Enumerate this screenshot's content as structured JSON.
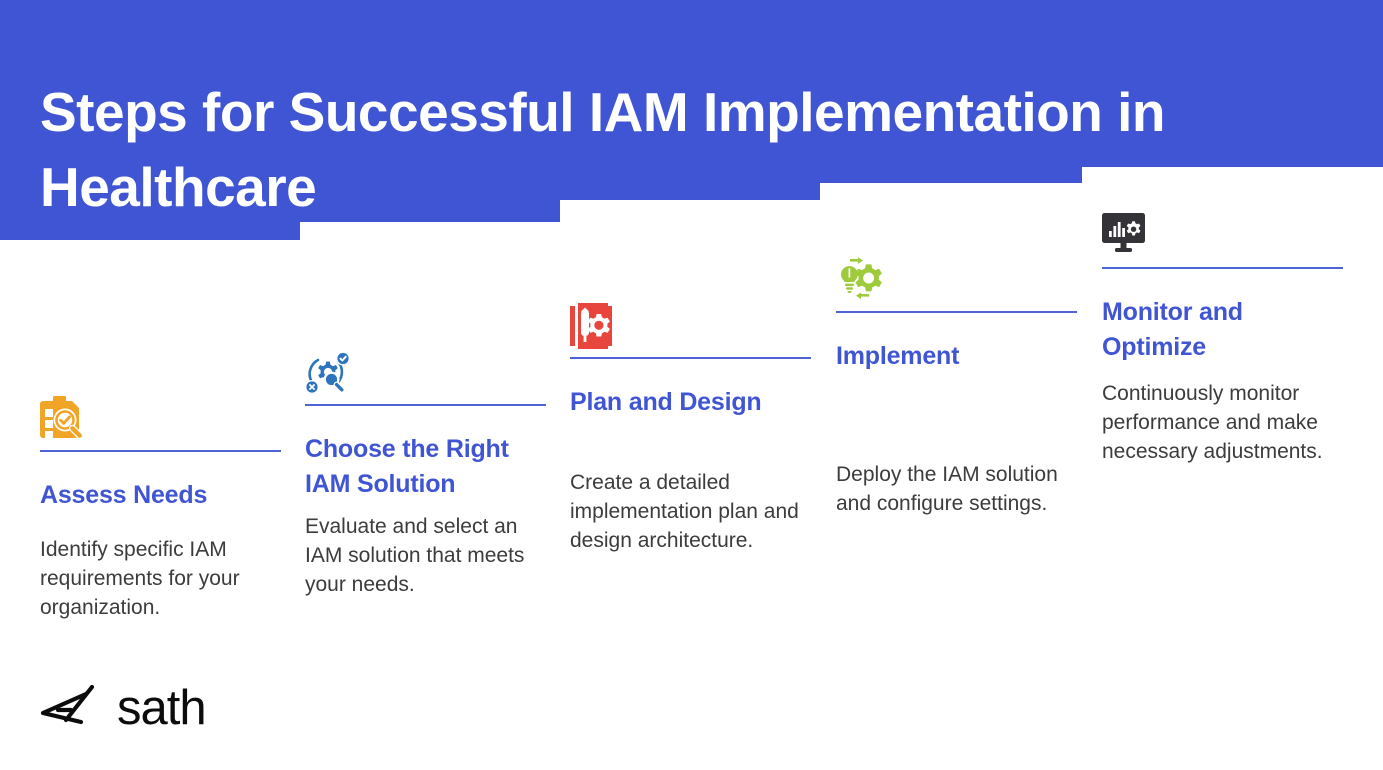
{
  "colors": {
    "header_blue": "#4055d4",
    "heading_blue": "#4055d4",
    "rule_blue": "#4f62d6",
    "body_gray": "#3c3c3c",
    "icon_orange": "#f0a526",
    "icon_blue": "#2d74bd",
    "icon_red": "#e8453c",
    "icon_green": "#9dcb3b",
    "icon_dark": "#343438",
    "background": "#ffffff"
  },
  "header": {
    "title": "Steps for Successful IAM Implementation in Healthcare",
    "title_line_1": "Steps for Successful IAM Implementation",
    "title_line_2": "in Healthcare"
  },
  "steps": [
    {
      "icon": "clipboard-search-icon",
      "heading": "Assess Needs",
      "body": "Identify specific IAM requirements for your organization."
    },
    {
      "icon": "gear-magnifier-icon",
      "heading": "Choose the Right IAM Solution",
      "body": "Evaluate and select an IAM solution that meets your needs."
    },
    {
      "icon": "blueprint-design-icon",
      "heading": "Plan and Design",
      "body": "Create a detailed implementation plan and design architecture."
    },
    {
      "icon": "lightbulb-gear-deploy-icon",
      "heading": "Implement",
      "body": "Deploy the IAM solution and configure settings."
    },
    {
      "icon": "monitor-analytics-icon",
      "heading": "Monitor and Optimize",
      "body": "Continuously monitor performance and make necessary adjustments."
    }
  ],
  "footer": {
    "logo_text": "sath",
    "logo_mark": "code-bracket-slash-mark"
  }
}
